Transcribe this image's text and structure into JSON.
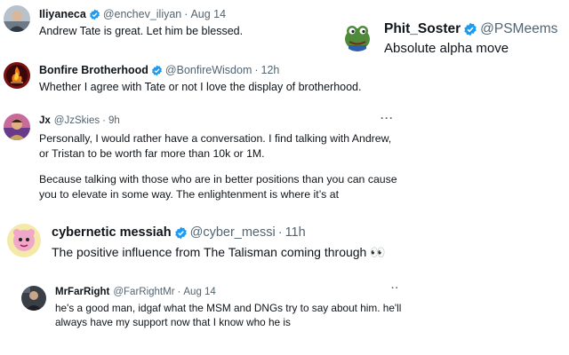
{
  "tweets": [
    {
      "name": "Iliyaneca",
      "handle": "@enchev_iliyan",
      "time": "Aug 14",
      "verified": true,
      "avatar_icon": "avatar-portrait-icon",
      "text": "Andrew Tate is great. Let him be blessed."
    },
    {
      "name": "Phit_Soster",
      "handle": "@PSMeems",
      "verified": true,
      "avatar_icon": "frog-avatar-icon",
      "text": "Absolute alpha move"
    },
    {
      "name": "Bonfire Brotherhood",
      "handle": "@BonfireWisdom",
      "time": "12h",
      "verified": true,
      "avatar_icon": "bonfire-logo-icon",
      "text": "Whether I agree with Tate or not I love the display of brotherhood."
    },
    {
      "name": "Jx",
      "handle": "@JzSkies",
      "time": "9h",
      "verified": false,
      "avatar_icon": "avatar-portrait-icon",
      "more": "···",
      "lines": [
        "Personally, I would rather have a conversation. I find talking with Andrew,",
        "or Tristan to be worth far more than 10k or 1M.",
        "Because talking with those who are in better positions than you can cause",
        "you to elevate in some way. The enlightenment is where it’s at"
      ]
    },
    {
      "name": "cybernetic messiah",
      "handle": "@cyber_messi",
      "time": "11h",
      "verified": true,
      "avatar_icon": "pink-character-avatar-icon",
      "text": "The positive influence from The Talisman coming through 👀"
    },
    {
      "name": "MrFarRight",
      "handle": "@FarRightMr",
      "time": "Aug 14",
      "verified": false,
      "avatar_icon": "avatar-portrait-icon",
      "more": "··",
      "lines": [
        "he's a good man, idgaf what the MSM and DNGs try to say about him. he'll",
        "always have my support now that I know who he is"
      ]
    }
  ],
  "separator": "·",
  "colors": {
    "verified": "#1d9bf0",
    "muted": "#536471",
    "text": "#0f1419"
  }
}
